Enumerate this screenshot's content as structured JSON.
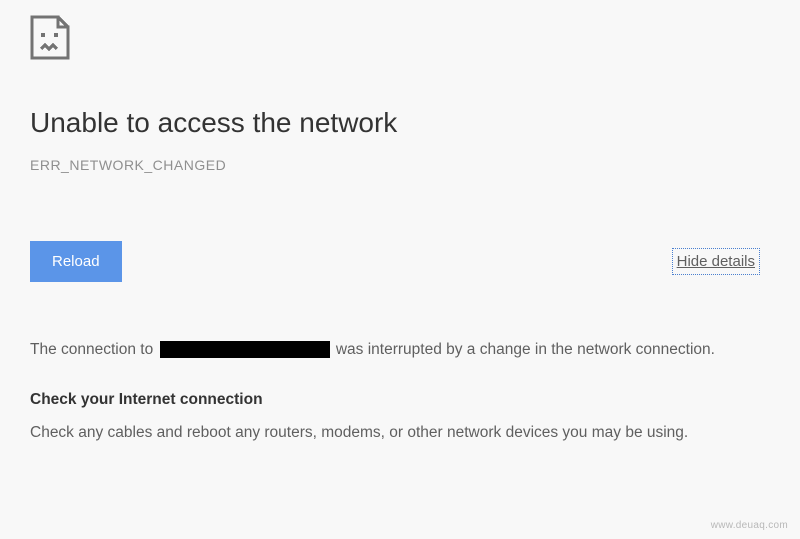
{
  "title": "Unable to access the network",
  "error_code": "ERR_NETWORK_CHANGED",
  "actions": {
    "reload_label": "Reload",
    "hide_details_label": "Hide details"
  },
  "details": {
    "line_prefix": "The connection to ",
    "redacted_host": "",
    "line_suffix": "was interrupted by a change in the network connection.",
    "subheader": "Check your Internet connection",
    "subtext": "Check any cables and reboot any routers, modems, or other network devices you may be using."
  },
  "watermark": "www.deuaq.com"
}
